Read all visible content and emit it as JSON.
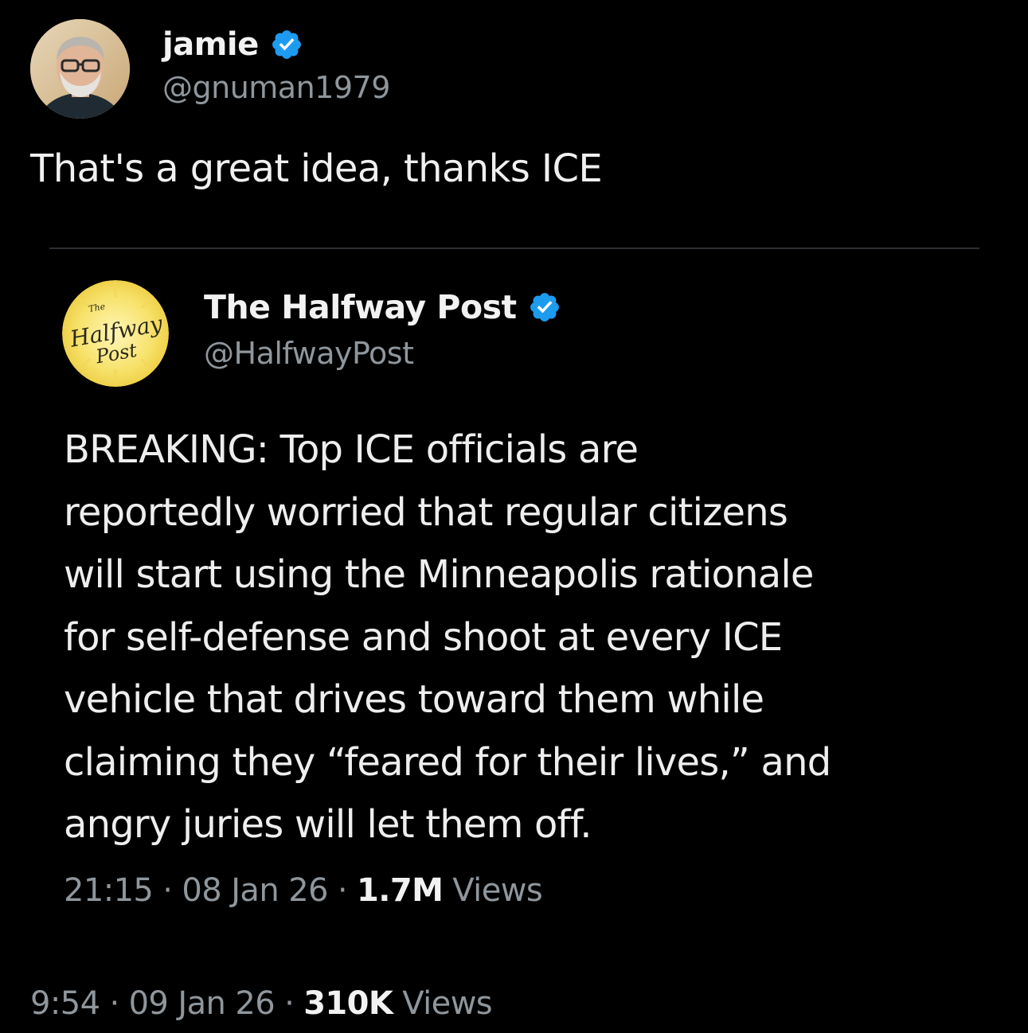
{
  "tweet": {
    "author": {
      "display_name": "jamie",
      "handle": "@gnuman1979",
      "verified": true,
      "avatar_icon": "profile-photo"
    },
    "text": "That's a great idea, thanks ICE",
    "meta": {
      "time": "9:54",
      "date": "09 Jan 26",
      "views_count": "310K",
      "views_label": "Views"
    }
  },
  "quoted_tweet": {
    "author": {
      "display_name": "The Halfway Post",
      "handle": "@HalfwayPost",
      "verified": true,
      "avatar_text": {
        "small": "The",
        "main": "Halfway",
        "sub": "Post"
      }
    },
    "lines": [
      "BREAKING: Top ICE officials are",
      "reportedly worried that regular citizens",
      "will start using the Minneapolis rationale",
      "for self-defense and shoot at every ICE",
      "vehicle that drives toward them while",
      "claiming they “feared for their lives,” and",
      "angry juries will let them off."
    ],
    "meta": {
      "time": "21:15",
      "date": "08 Jan 26",
      "views_count": "1.7M",
      "views_label": "Views"
    }
  },
  "separator": "·",
  "colors": {
    "background": "#000000",
    "text_primary": "#f2f2f2",
    "text_secondary": "#8f969c",
    "verified_blue": "#1d9bf0",
    "halfway_logo_yellow": "#f7e26b"
  }
}
